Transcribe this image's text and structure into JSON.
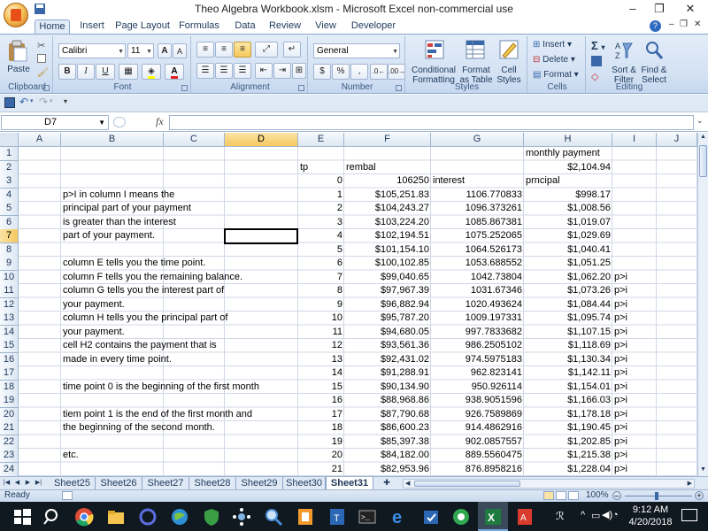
{
  "window": {
    "title": "Theo Algebra Workbook.xlsm - Microsoft Excel non-commercial use",
    "minimize": "–",
    "restore": "❐",
    "close": "✕"
  },
  "ribbon_tabs": [
    "Home",
    "Insert",
    "Page Layout",
    "Formulas",
    "Data",
    "Review",
    "View",
    "Developer"
  ],
  "ribbon": {
    "groups": [
      "Clipboard",
      "Font",
      "Alignment",
      "Number",
      "Styles",
      "Cells",
      "Editing"
    ],
    "paste_label": "Paste",
    "font_name": "Calibri",
    "font_size": "11",
    "bold": "B",
    "italic": "I",
    "underline": "U",
    "grow_font": "A",
    "shrink_font": "A",
    "number_format": "General",
    "currency": "$",
    "percent": "%",
    "comma": ",",
    "conditional_formatting": "Conditional\nFormatting",
    "format_as_table": "Format\nas Table",
    "cell_styles": "Cell\nStyles",
    "insert": "Insert",
    "delete": "Delete",
    "format": "Format",
    "sort_filter": "Sort &\nFilter",
    "find_select": "Find &\nSelect",
    "sigma": "Σ"
  },
  "formula_bar": {
    "name_box": "D7",
    "fx": "fx",
    "formula": ""
  },
  "columns": [
    "A",
    "B",
    "C",
    "D",
    "E",
    "F",
    "G",
    "H",
    "I",
    "J"
  ],
  "rows": [
    "1",
    "2",
    "3",
    "4",
    "5",
    "6",
    "7",
    "8",
    "9",
    "10",
    "11",
    "12",
    "13",
    "14",
    "15",
    "16",
    "17",
    "18",
    "19",
    "20",
    "21",
    "22",
    "23",
    "24"
  ],
  "cells": {
    "H1": "monthly payment",
    "E2": "tp",
    "F2": "rembal",
    "H2": "$2,104.94",
    "E3": "0",
    "F3": "106250",
    "G3": "interest",
    "H3": "prncipal",
    "B4": "p>I in column I means the",
    "B5": "principal part of your payment",
    "B6": "is greater than the interest",
    "B7": "part of your payment.",
    "B9": "column E tells you the time point.",
    "B10": "column F tells you the remaining balance.",
    "B11": "column G tells you the interest part of",
    "B12": "your payment.",
    "B13": "column  H tells you the principal part of",
    "B14": "your payment.",
    "B15": "cell H2 contains the payment that is",
    "B16": "made in every time point.",
    "B18": "time point 0 is the beginning of the first month",
    "B20": "tiem point 1 is the end of the first month and",
    "B21": "the beginning of the second month.",
    "B23": "etc."
  },
  "table_rows": [
    {
      "row": "4",
      "tp": "1",
      "rembal": "$105,251.83",
      "interest": "1106.770833",
      "principal": "$998.17",
      "flag": ""
    },
    {
      "row": "5",
      "tp": "2",
      "rembal": "$104,243.27",
      "interest": "1096.373261",
      "principal": "$1,008.56",
      "flag": ""
    },
    {
      "row": "6",
      "tp": "3",
      "rembal": "$103,224.20",
      "interest": "1085.867381",
      "principal": "$1,019.07",
      "flag": ""
    },
    {
      "row": "7",
      "tp": "4",
      "rembal": "$102,194.51",
      "interest": "1075.252065",
      "principal": "$1,029.69",
      "flag": ""
    },
    {
      "row": "8",
      "tp": "5",
      "rembal": "$101,154.10",
      "interest": "1064.526173",
      "principal": "$1,040.41",
      "flag": ""
    },
    {
      "row": "9",
      "tp": "6",
      "rembal": "$100,102.85",
      "interest": "1053.688552",
      "principal": "$1,051.25",
      "flag": ""
    },
    {
      "row": "10",
      "tp": "7",
      "rembal": "$99,040.65",
      "interest": "1042.73804",
      "principal": "$1,062.20",
      "flag": "p>i"
    },
    {
      "row": "11",
      "tp": "8",
      "rembal": "$97,967.39",
      "interest": "1031.67346",
      "principal": "$1,073.26",
      "flag": "p>i"
    },
    {
      "row": "12",
      "tp": "9",
      "rembal": "$96,882.94",
      "interest": "1020.493624",
      "principal": "$1,084.44",
      "flag": "p>i"
    },
    {
      "row": "13",
      "tp": "10",
      "rembal": "$95,787.20",
      "interest": "1009.197331",
      "principal": "$1,095.74",
      "flag": "p>i"
    },
    {
      "row": "14",
      "tp": "11",
      "rembal": "$94,680.05",
      "interest": "997.7833682",
      "principal": "$1,107.15",
      "flag": "p>i"
    },
    {
      "row": "15",
      "tp": "12",
      "rembal": "$93,561.36",
      "interest": "986.2505102",
      "principal": "$1,118.69",
      "flag": "p>i"
    },
    {
      "row": "16",
      "tp": "13",
      "rembal": "$92,431.02",
      "interest": "974.5975183",
      "principal": "$1,130.34",
      "flag": "p>i"
    },
    {
      "row": "17",
      "tp": "14",
      "rembal": "$91,288.91",
      "interest": "962.823141",
      "principal": "$1,142.11",
      "flag": "p>i"
    },
    {
      "row": "18",
      "tp": "15",
      "rembal": "$90,134.90",
      "interest": "950.926114",
      "principal": "$1,154.01",
      "flag": "p>i"
    },
    {
      "row": "19",
      "tp": "16",
      "rembal": "$88,968.86",
      "interest": "938.9051596",
      "principal": "$1,166.03",
      "flag": "p>i"
    },
    {
      "row": "20",
      "tp": "17",
      "rembal": "$87,790.68",
      "interest": "926.7589869",
      "principal": "$1,178.18",
      "flag": "p>i"
    },
    {
      "row": "21",
      "tp": "18",
      "rembal": "$86,600.23",
      "interest": "914.4862916",
      "principal": "$1,190.45",
      "flag": "p>i"
    },
    {
      "row": "22",
      "tp": "19",
      "rembal": "$85,397.38",
      "interest": "902.0857557",
      "principal": "$1,202.85",
      "flag": "p>i"
    },
    {
      "row": "23",
      "tp": "20",
      "rembal": "$84,182.00",
      "interest": "889.5560475",
      "principal": "$1,215.38",
      "flag": "p>i"
    },
    {
      "row": "24",
      "tp": "21",
      "rembal": "$82,953.96",
      "interest": "876.8958216",
      "principal": "$1,228.04",
      "flag": "p>i"
    }
  ],
  "sheet_tabs": [
    "Sheet25",
    "Sheet26",
    "Sheet27",
    "Sheet28",
    "Sheet29",
    "Sheet30",
    "Sheet31"
  ],
  "active_sheet": "Sheet31",
  "status": {
    "ready": "Ready",
    "zoom": "100%"
  },
  "taskbar": {
    "time": "9:12 AM",
    "date": "4/20/2018"
  },
  "colors": {
    "accent": "#1e395b",
    "ribbon_bg": "#d3e1f3",
    "header_selected": "#f6c85f",
    "taskbar_bg": "#101820"
  }
}
